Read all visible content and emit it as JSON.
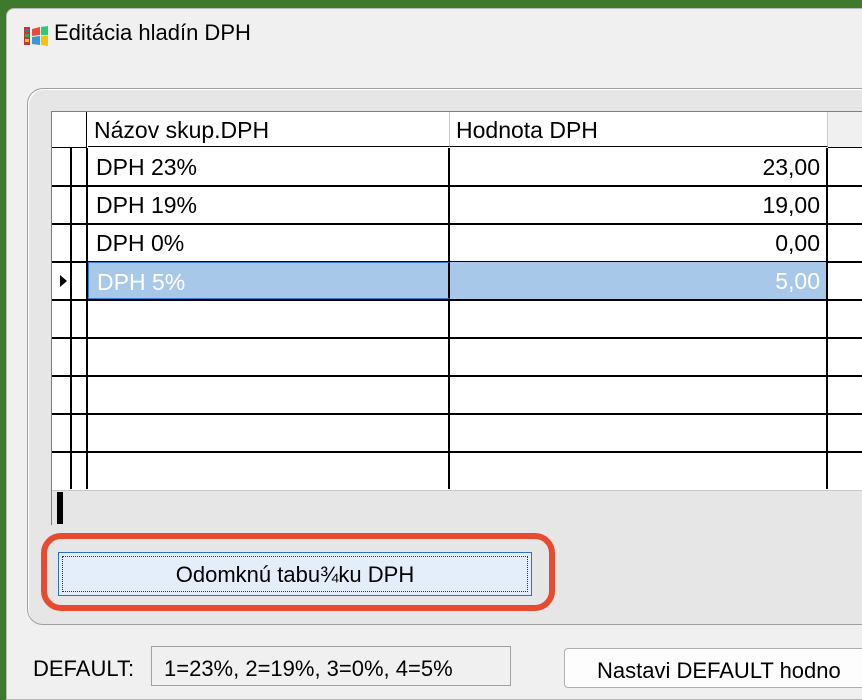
{
  "window": {
    "title": "Editácia hladín DPH",
    "icon": "windows-app-icon"
  },
  "grid": {
    "columns": [
      "Názov skup.DPH",
      "Hodnota DPH"
    ],
    "rows": [
      {
        "name": "DPH 23%",
        "value": "23,00"
      },
      {
        "name": "DPH 19%",
        "value": "19,00"
      },
      {
        "name": "DPH  0%",
        "value": "0,00"
      },
      {
        "name": "DPH  5%",
        "value": "5,00"
      }
    ],
    "selected_row": 4,
    "selected_color": "#a8c8ea"
  },
  "actions": {
    "unlock_label": "Odomknú tabu¾ku DPH",
    "highlight_color": "#e84a2f"
  },
  "footer": {
    "default_label": "DEFAULT:",
    "default_value": "1=23%, 2=19%, 3=0%, 4=5%",
    "set_default_label": "Nastavi DEFAULT hodno"
  }
}
